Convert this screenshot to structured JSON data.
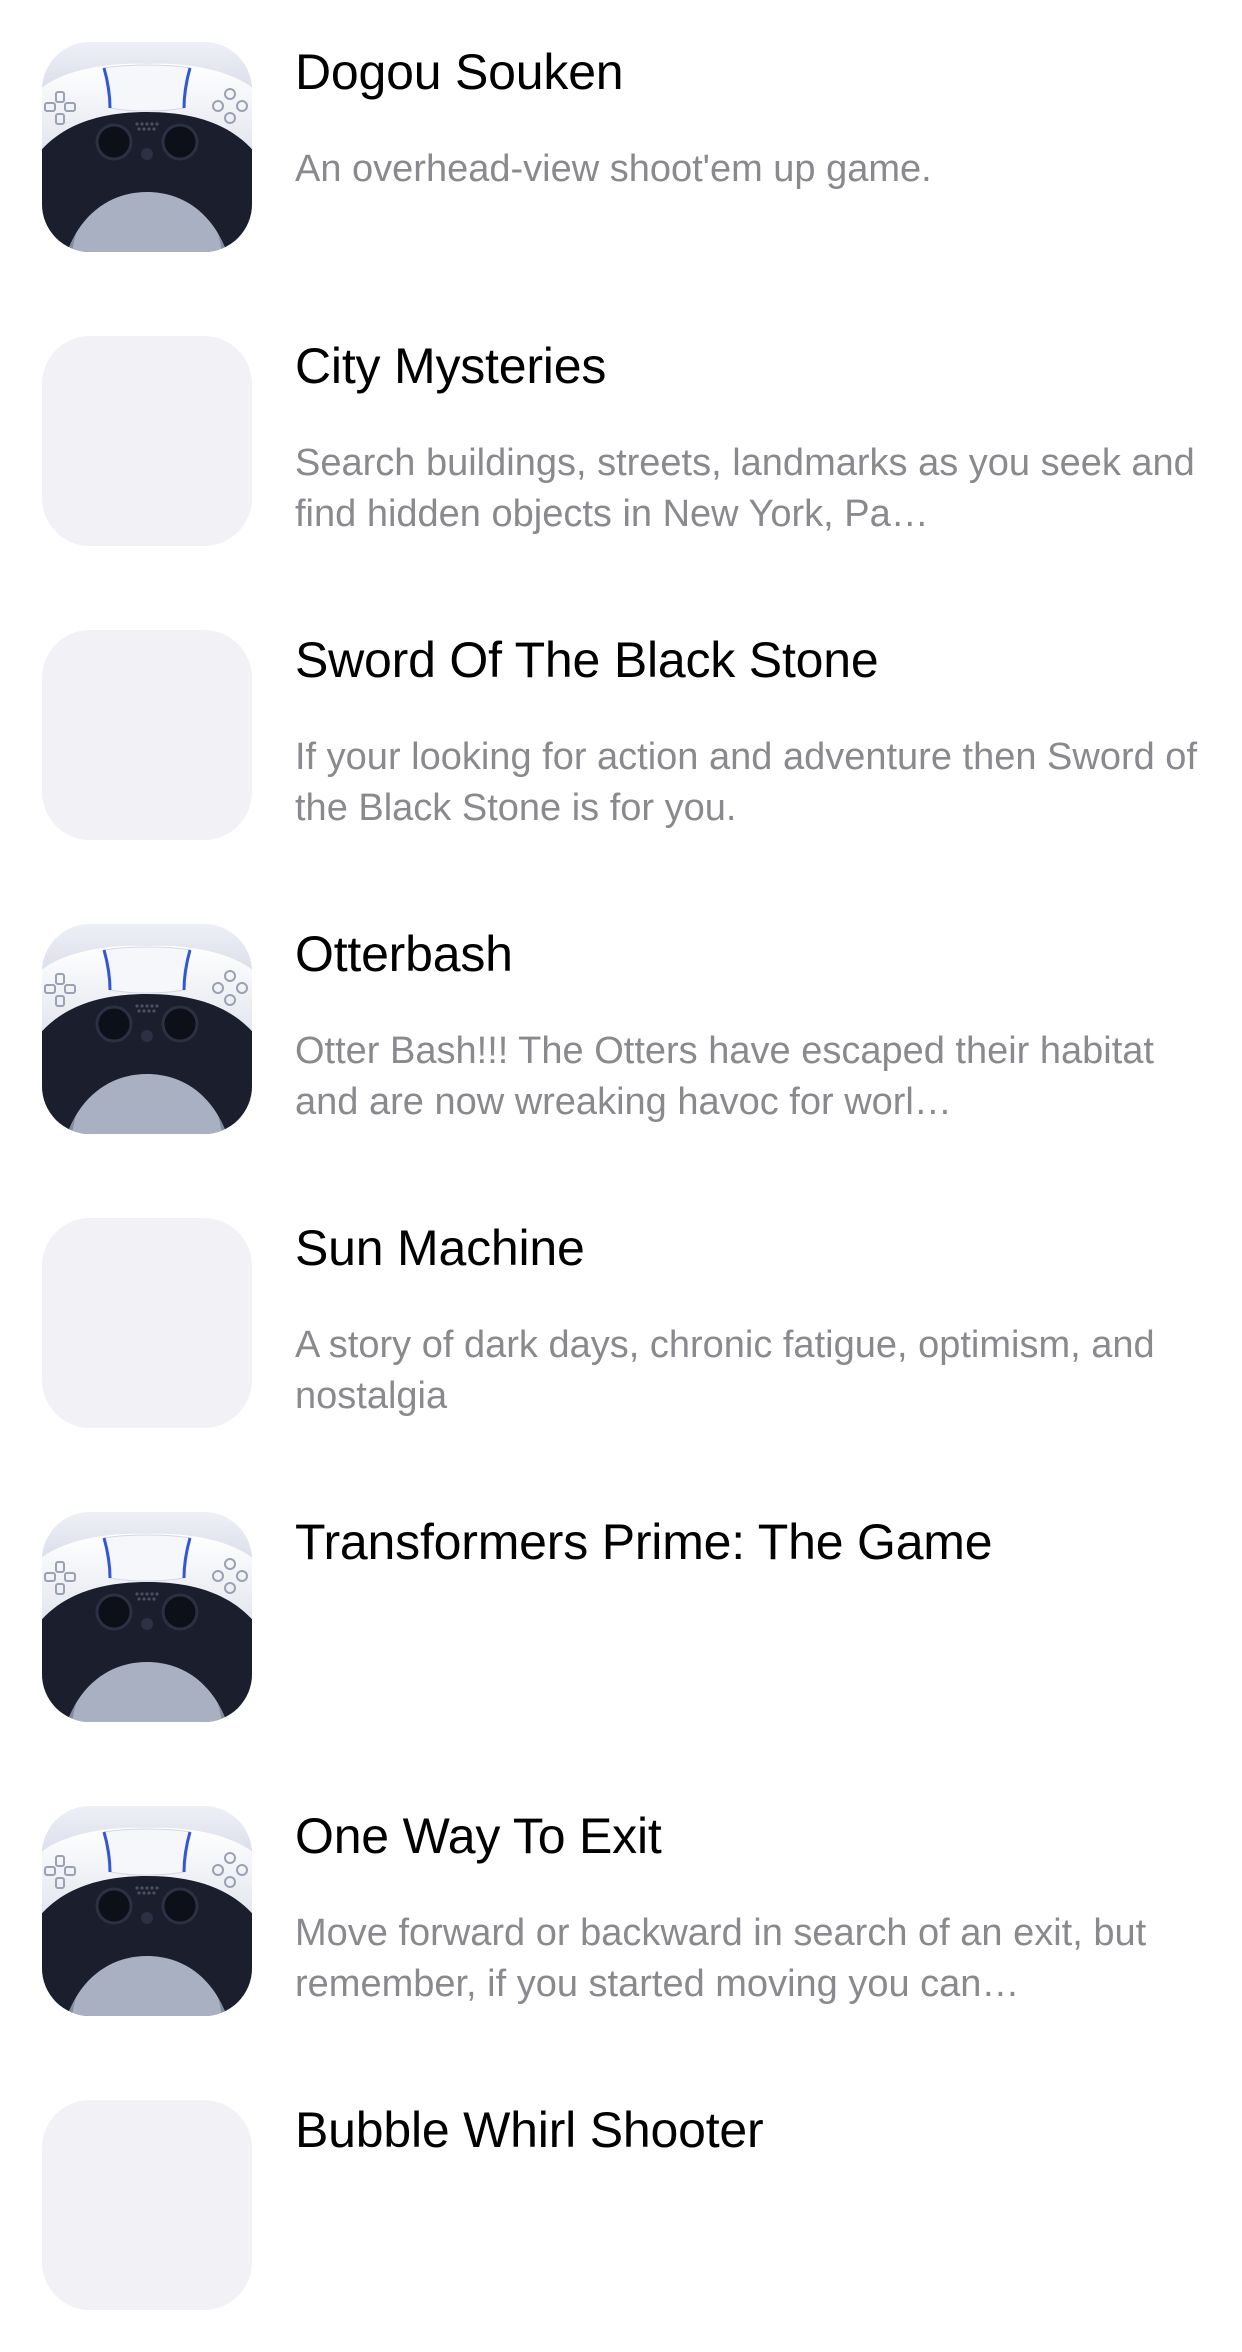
{
  "games": [
    {
      "title": "Dogou Souken",
      "description": "An overhead-view shoot'em up game.",
      "icon": "game-controller-icon"
    },
    {
      "title": "City Mysteries",
      "description": "Search buildings, streets, landmarks as you seek and find hidden objects in New York, Pa…",
      "icon": "placeholder"
    },
    {
      "title": "Sword Of The Black Stone",
      "description": "If your looking for action and adventure then Sword of the Black Stone is for you.",
      "icon": "placeholder"
    },
    {
      "title": "Otterbash",
      "description": "Otter Bash!!! The Otters have escaped their habitat and are now wreaking havoc for worl…",
      "icon": "game-controller-icon"
    },
    {
      "title": "Sun Machine",
      "description": "A story of dark days, chronic fatigue, optimism, and nostalgia",
      "icon": "placeholder"
    },
    {
      "title": "Transformers Prime: The Game",
      "description": "",
      "icon": "game-controller-icon"
    },
    {
      "title": "One Way To Exit",
      "description": "Move forward or backward in search of an exit, but remember, if you started moving you can…",
      "icon": "game-controller-icon"
    },
    {
      "title": "Bubble Whirl Shooter",
      "description": "",
      "icon": "placeholder"
    }
  ],
  "colors": {
    "title": "#000000",
    "description": "#8a8a8e",
    "placeholder_icon": "#f1f1f6",
    "controller_accent": "#3355d8"
  }
}
